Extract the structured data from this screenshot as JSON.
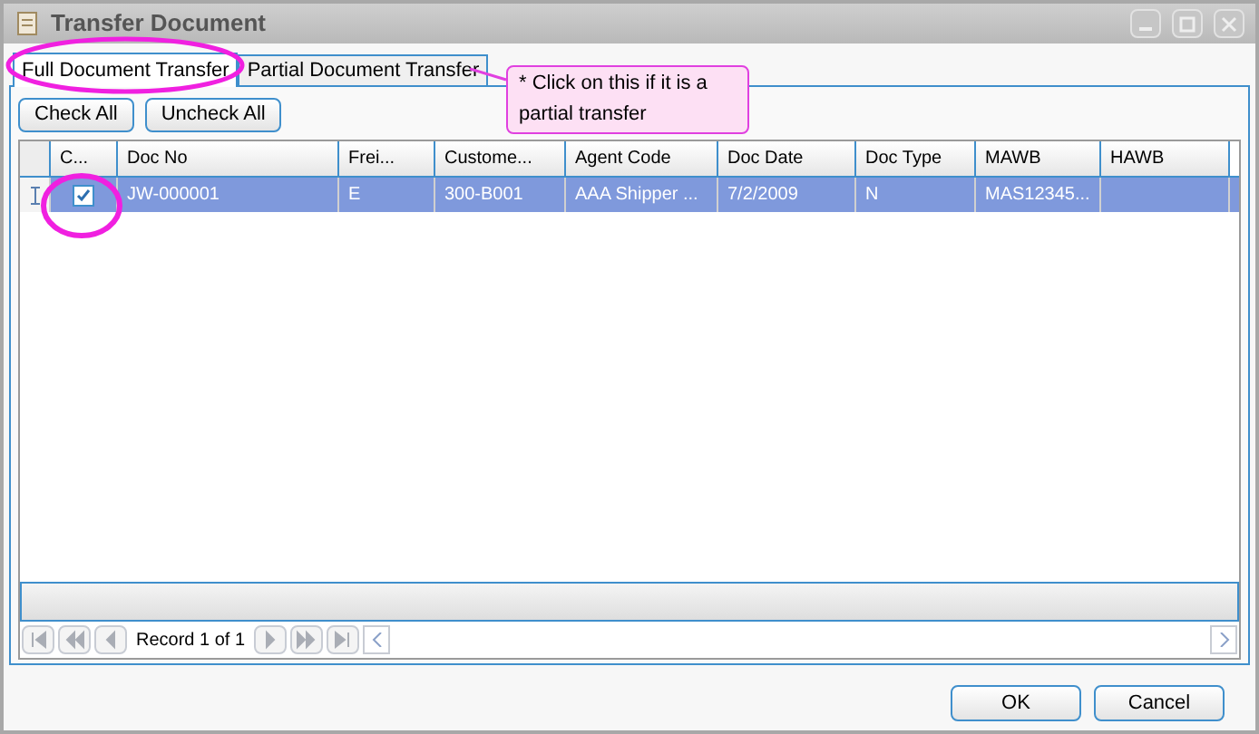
{
  "window": {
    "title": "Transfer Document"
  },
  "tabs": [
    {
      "label": "Full Document Transfer",
      "selected": true
    },
    {
      "label": "Partial Document Transfer",
      "selected": false
    }
  ],
  "callout": {
    "text": "* Click on this if it is a partial transfer"
  },
  "toolbar": [
    "Check All",
    "Uncheck All"
  ],
  "table": {
    "columns": [
      "C...",
      "Doc No",
      "Frei...",
      "Custome...",
      "Agent Code",
      "Doc Date",
      "Doc Type",
      "MAWB",
      "HAWB"
    ],
    "rows": [
      {
        "selected": true,
        "checked": true,
        "cells": [
          "",
          "JW-000001",
          "E",
          "300-B001",
          "AAA Shipper ...",
          "7/2/2009",
          "N",
          "MAS12345...",
          ""
        ]
      }
    ]
  },
  "navigator": {
    "text": "Record 1 of 1"
  },
  "buttons": [
    "OK",
    "Cancel"
  ]
}
